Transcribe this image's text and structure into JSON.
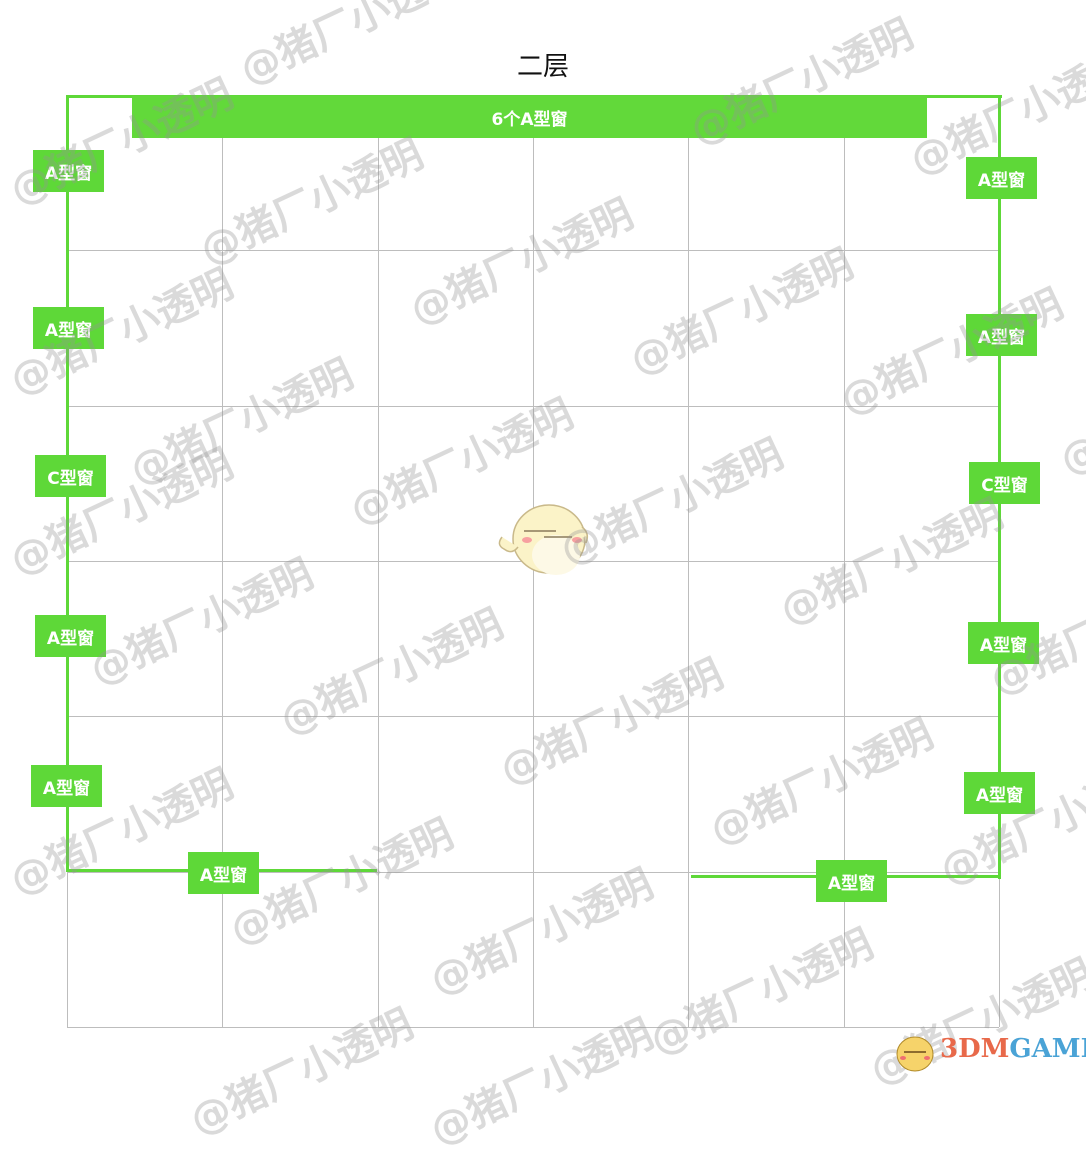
{
  "diagram": {
    "title": "二层",
    "top_window_bar": "6个A型窗",
    "grid": {
      "columns": 6,
      "rows": 6
    },
    "left_windows": [
      "A型窗",
      "A型窗",
      "C型窗",
      "A型窗",
      "A型窗"
    ],
    "right_windows": [
      "A型窗",
      "A型窗",
      "C型窗",
      "A型窗",
      "A型窗"
    ],
    "bottom_windows": [
      "A型窗",
      "A型窗"
    ],
    "wall_color": "#5ed838",
    "grid_color": "#bdbdbd"
  },
  "watermark": {
    "text": "@猪厂小透明"
  },
  "logo": {
    "text_a": "3DM",
    "text_b": "GAME"
  }
}
